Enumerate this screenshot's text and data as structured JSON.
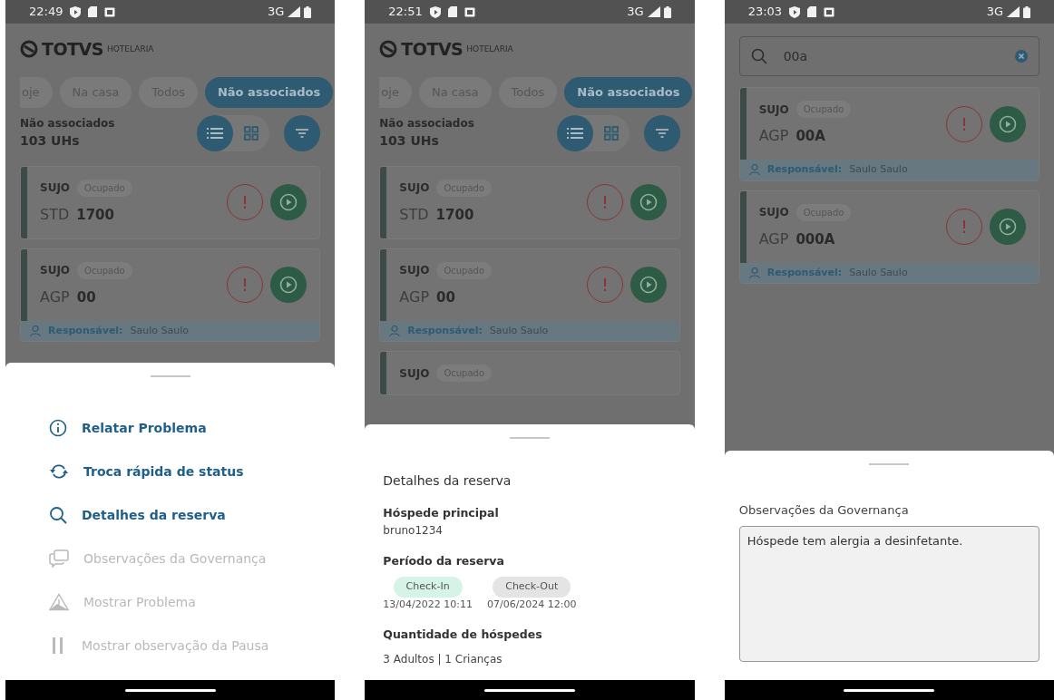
{
  "screens": [
    {
      "status_bar": {
        "time": "22:49",
        "network": "3G"
      },
      "header": {
        "logo": "TOTVS",
        "logo_sub": "HOTELARIA"
      },
      "filter_tabs": [
        {
          "label": "oje",
          "selected": false
        },
        {
          "label": "Na casa",
          "selected": false
        },
        {
          "label": "Todos",
          "selected": false
        },
        {
          "label": "Não associados",
          "selected": true
        }
      ],
      "summary": {
        "title": "Não associados",
        "count": "103 UHs"
      },
      "view_toggle": [
        {
          "kind": "list",
          "selected": true
        },
        {
          "kind": "grid",
          "selected": false
        }
      ],
      "rooms": [
        {
          "status": "SUJO",
          "occupancy": "Ocupado",
          "type": "STD",
          "number": "1700"
        },
        {
          "status": "SUJO",
          "occupancy": "Ocupado",
          "type": "AGP",
          "number": "00",
          "responsible_label": "Responsável:",
          "responsible": "Saulo Saulo"
        }
      ],
      "sheet": {
        "kind": "menu",
        "items": [
          {
            "kind": "info",
            "label": "Relatar Problema",
            "disabled": false
          },
          {
            "kind": "sync",
            "label": "Troca rápida de status",
            "disabled": false
          },
          {
            "kind": "search",
            "label": "Detalhes da reserva",
            "disabled": false
          },
          {
            "kind": "chat",
            "label": "Observações da Governança",
            "disabled": true
          },
          {
            "kind": "warning",
            "label": "Mostrar Problema",
            "disabled": true
          },
          {
            "kind": "pause",
            "label": "Mostrar observação da Pausa",
            "disabled": true
          }
        ]
      }
    },
    {
      "status_bar": {
        "time": "22:51",
        "network": "3G"
      },
      "header": {
        "logo": "TOTVS",
        "logo_sub": "HOTELARIA"
      },
      "filter_tabs": [
        {
          "label": "oje",
          "selected": false
        },
        {
          "label": "Na casa",
          "selected": false
        },
        {
          "label": "Todos",
          "selected": false
        },
        {
          "label": "Não associados",
          "selected": true
        }
      ],
      "summary": {
        "title": "Não associados",
        "count": "103 UHs"
      },
      "view_toggle": [
        {
          "kind": "list",
          "selected": true
        },
        {
          "kind": "grid",
          "selected": false
        }
      ],
      "rooms": [
        {
          "status": "SUJO",
          "occupancy": "Ocupado",
          "type": "STD",
          "number": "1700"
        },
        {
          "status": "SUJO",
          "occupancy": "Ocupado",
          "type": "AGP",
          "number": "00",
          "responsible_label": "Responsável:",
          "responsible": "Saulo Saulo"
        },
        {
          "status": "SUJO",
          "occupancy": "Ocupado"
        }
      ],
      "sheet": {
        "kind": "details",
        "title": "Detalhes da reserva",
        "guest_label": "Hóspede principal",
        "guest": "bruno1234",
        "period_label": "Período da reserva",
        "period": [
          {
            "label": "Check-In",
            "date": "13/04/2022 10:11",
            "color": "#d5f3e6"
          },
          {
            "label": "Check-Out",
            "date": "07/06/2024 12:00",
            "color": "#e4e4e4"
          }
        ],
        "guests_label": "Quantidade de hóspedes",
        "guests": "3 Adultos | 1 Crianças"
      }
    },
    {
      "status_bar": {
        "time": "23:03",
        "network": "3G"
      },
      "search": {
        "value": "00a"
      },
      "rooms": [
        {
          "status": "SUJO",
          "occupancy": "Ocupado",
          "type": "AGP",
          "number": "00A",
          "responsible_label": "Responsável:",
          "responsible": "Saulo Saulo"
        },
        {
          "status": "SUJO",
          "occupancy": "Ocupado",
          "type": "AGP",
          "number": "000A",
          "responsible_label": "Responsável:",
          "responsible": "Saulo Saulo"
        }
      ],
      "sheet": {
        "kind": "notes",
        "title": "Observações da Governança",
        "text": "Hóspede tem alergia a desinfetante."
      }
    }
  ]
}
